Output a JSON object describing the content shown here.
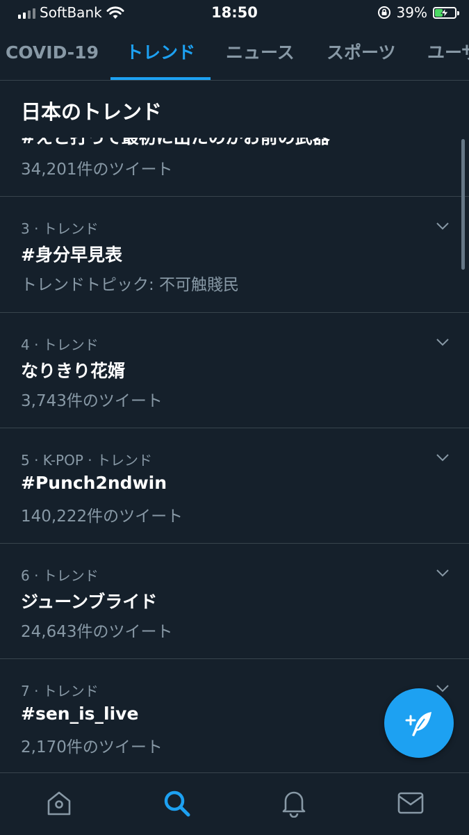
{
  "status_bar": {
    "carrier": "SoftBank",
    "time": "18:50",
    "battery_percent": "39%",
    "battery_level": 0.39
  },
  "tabs": [
    {
      "label": "COVID-19"
    },
    {
      "label": "トレンド"
    },
    {
      "label": "ニュース"
    },
    {
      "label": "スポーツ"
    },
    {
      "label": "ユーザ"
    }
  ],
  "section": {
    "title": "日本のトレンド"
  },
  "trends": [
    {
      "meta": "",
      "name": "#えと打って最初に出たのがお前の武器",
      "sub": "34,201件のツイート"
    },
    {
      "meta": "3 · トレンド",
      "name": "#身分早見表",
      "sub": "トレンドトピック: 不可触賤民"
    },
    {
      "meta": "4 · トレンド",
      "name": "なりきり花婿",
      "sub": "3,743件のツイート"
    },
    {
      "meta": "5 · K-POP · トレンド",
      "name": "#Punch2ndwin",
      "sub": "140,222件のツイート"
    },
    {
      "meta": "6 · トレンド",
      "name": "ジューンブライド",
      "sub": "24,643件のツイート"
    },
    {
      "meta": "7 · トレンド",
      "name": "#sen_is_live",
      "sub": "2,170件のツイート"
    }
  ],
  "icons": {
    "home": "home-icon",
    "search": "search-icon",
    "notifications": "bell-icon",
    "messages": "mail-icon",
    "compose": "compose-tweet-icon"
  },
  "colors": {
    "background": "#15202b",
    "accent": "#1da1f2",
    "muted_text": "#8899a6",
    "divider": "#38444d"
  }
}
